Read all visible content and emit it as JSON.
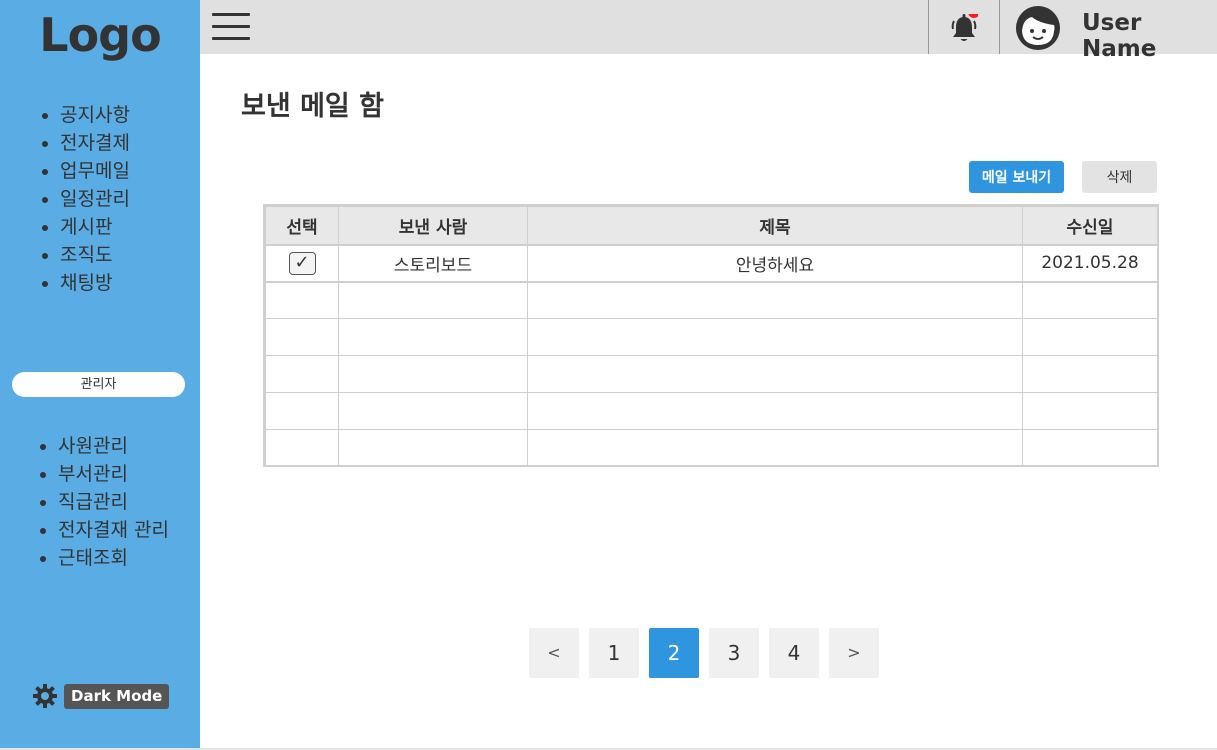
{
  "sidebar": {
    "logo": "Logo",
    "main_menu": [
      "공지사항",
      "전자결제",
      "업무메일",
      "일정관리",
      "게시판",
      "조직도",
      "채팅방"
    ],
    "admin_label": "관리자",
    "admin_menu": [
      "사원관리",
      "부서관리",
      "직급관리",
      "전자결재 관리",
      "근태조회"
    ],
    "dark_mode_label": "Dark Mode"
  },
  "header": {
    "user_name": "User Name",
    "notification_dot_color": "#ff1a1a"
  },
  "main": {
    "title": "보낸 메일 함",
    "send_button": "메일 보내기",
    "delete_button": "삭제",
    "columns": [
      "선택",
      "보낸 사람",
      "제목",
      "수신일"
    ],
    "rows": [
      {
        "checked": true,
        "check_glyph": "✓",
        "sender": "스토리보드",
        "subject": "안녕하세요",
        "date": "2021.05.28"
      },
      {
        "sender": "",
        "subject": "",
        "date": ""
      },
      {
        "sender": "",
        "subject": "",
        "date": ""
      },
      {
        "sender": "",
        "subject": "",
        "date": ""
      },
      {
        "sender": "",
        "subject": "",
        "date": ""
      },
      {
        "sender": "",
        "subject": "",
        "date": ""
      }
    ]
  },
  "pagination": {
    "prev": "<",
    "pages": [
      "1",
      "2",
      "3",
      "4"
    ],
    "current": "2",
    "next": ">"
  },
  "colors": {
    "sidebar": "#5aace4",
    "accent": "#2e95de",
    "header": "#e0e0e0"
  }
}
